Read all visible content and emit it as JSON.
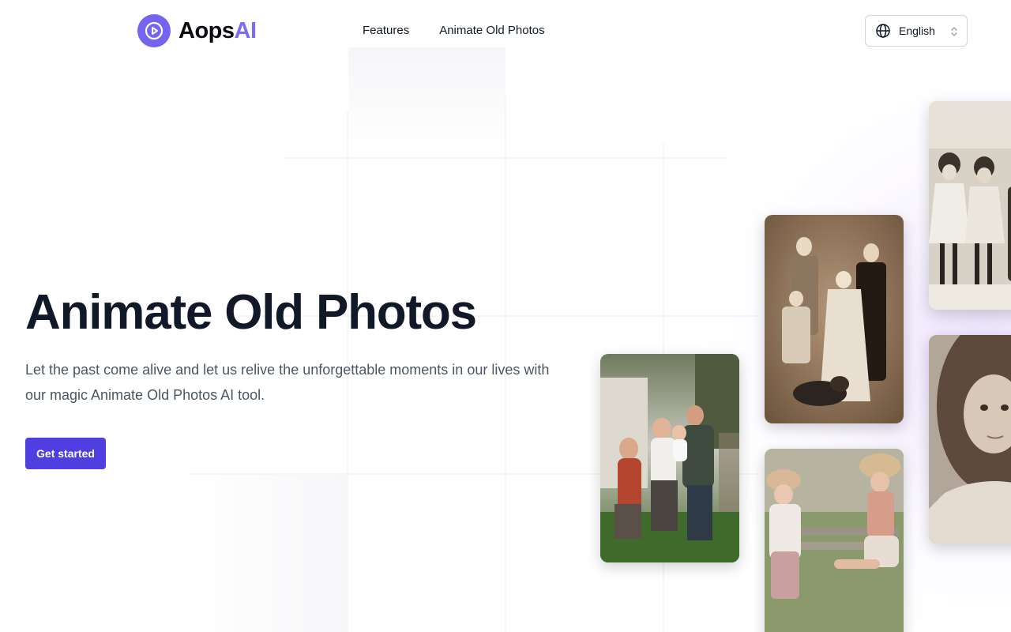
{
  "header": {
    "logo": {
      "name_part1": "Aops",
      "name_part2": "AI",
      "icon": "play-icon"
    },
    "nav": [
      {
        "label": "Features"
      },
      {
        "label": "Animate Old Photos"
      }
    ],
    "language": {
      "selected": "English",
      "icon": "globe-icon"
    }
  },
  "hero": {
    "title": "Animate Old Photos",
    "description": "Let the past come alive and let us relive the unforgettable moments in our lives with our magic Animate Old Photos AI tool.",
    "cta_label": "Get started"
  },
  "gallery": [
    {
      "subject": "color family photo in garden"
    },
    {
      "subject": "sepia family portrait with dog"
    },
    {
      "subject": "two girls with sun hats on bench"
    },
    {
      "subject": "children group vintage photo"
    },
    {
      "subject": "vintage girl portrait"
    }
  ],
  "colors": {
    "accent": "#7b6cf3",
    "button": "#4f3fe0",
    "title": "#111827",
    "body_text": "#4b5563"
  }
}
